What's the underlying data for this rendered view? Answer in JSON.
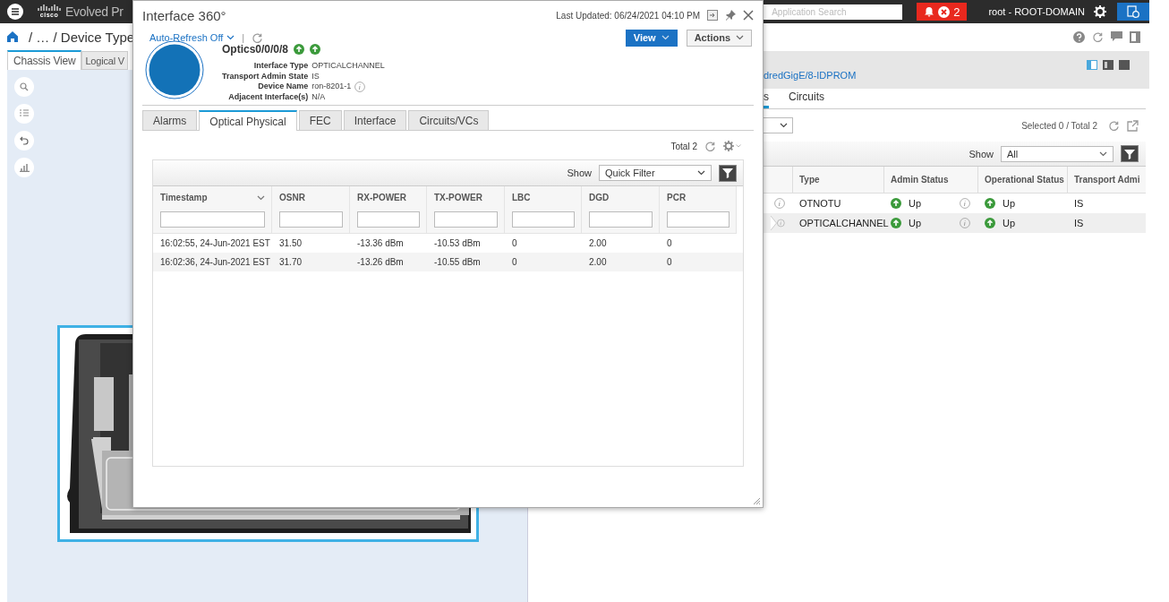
{
  "top_bar": {
    "logo_text": "cisco",
    "product_name": "Evolved Pr",
    "search": {
      "placeholder": "Application Search"
    },
    "alarm_count": "2",
    "user": "root - ROOT-DOMAIN"
  },
  "breadcrumb": "/ … / Device Type",
  "left_tabs": [
    {
      "label": "Chassis View",
      "selected": true
    },
    {
      "label": "Logical V",
      "selected": false
    }
  ],
  "detail_panel": {
    "link": "dredGigE/8-IDPROM",
    "tabs": [
      {
        "label": "s",
        "selected": true
      },
      {
        "label": "Circuits",
        "selected": false
      }
    ],
    "summary": "Selected 0 / Total 2",
    "show_label": "Show",
    "show_value": "All",
    "columns": [
      "Type",
      "Admin Status",
      "Operational Status",
      "Transport Admi"
    ],
    "rows": [
      {
        "type": "OTNOTU",
        "admin_status": "Up",
        "operational_status": "Up",
        "transport_admin": "IS",
        "selected": false
      },
      {
        "type": "OPTICALCHANNEL",
        "admin_status": "Up",
        "operational_status": "Up",
        "transport_admin": "IS",
        "selected": true
      }
    ]
  },
  "dialog": {
    "title": "Interface 360°",
    "last_updated": "Last Updated: 06/24/2021 04:10 PM",
    "auto_refresh": "Auto-Refresh Off",
    "separator": "|",
    "buttons": [
      {
        "label": "View",
        "primary": true
      },
      {
        "label": "Actions",
        "primary": false
      }
    ],
    "interface_name": "Optics0/0/0/8",
    "properties": [
      {
        "label": "Interface Type",
        "value": "OPTICALCHANNEL",
        "info": false
      },
      {
        "label": "Transport Admin State",
        "value": "IS",
        "info": false
      },
      {
        "label": "Device Name",
        "value": "ron-8201-1",
        "info": true
      },
      {
        "label": "Adjacent Interface(s)",
        "value": "N/A",
        "info": false
      }
    ],
    "tabs": [
      {
        "label": "Alarms",
        "selected": false
      },
      {
        "label": "Optical Physical",
        "selected": true
      },
      {
        "label": "FEC",
        "selected": false
      },
      {
        "label": "Interface",
        "selected": false
      },
      {
        "label": "Circuits/VCs",
        "selected": false
      }
    ],
    "total": "Total 2",
    "show_label": "Show",
    "filter": "Quick Filter",
    "table": {
      "columns": [
        "Timestamp",
        "OSNR",
        "RX-POWER",
        "TX-POWER",
        "LBC",
        "DGD",
        "PCR"
      ],
      "rows": [
        [
          "16:02:55, 24-Jun-2021 EST",
          "31.50",
          "-13.36 dBm",
          "-10.53 dBm",
          "0",
          "2.00",
          "0"
        ],
        [
          "16:02:36, 24-Jun-2021 EST",
          "31.70",
          "-13.26 dBm",
          "-10.55 dBm",
          "0",
          "2.00",
          "0"
        ]
      ]
    }
  }
}
